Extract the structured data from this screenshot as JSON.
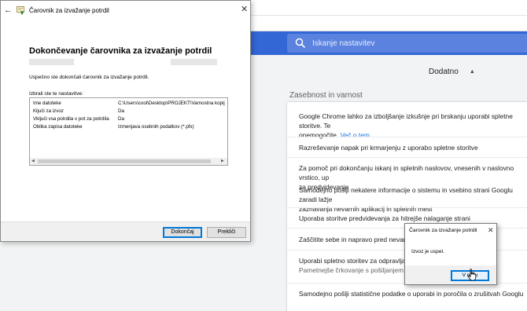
{
  "chrome": {
    "search_placeholder": "Iskanje nastavitev",
    "advanced_label": "Dodatno",
    "section_title": "Zasebnost in varnost",
    "settings": [
      {
        "text": "Google Chrome lahko za izboljšanje izkušnje pri brskanju uporabi spletne storitve. Te",
        "line2": "onemogočite.",
        "link": "Več o tem"
      },
      {
        "text": "Razreševanje napak pri krmarjenju z uporabo spletne storitve"
      },
      {
        "text": "Za pomoč pri dokončanju iskanj in spletnih naslovov, vnesenih v naslovno vrstico, up",
        "line2": "za predvidevanje"
      },
      {
        "text": "Samodejno pošlji nekatere informacije o sistemu in vsebino strani Googlu zaradi lažje",
        "line2": "zaznavanja nevarnih aplikacij in spletnih mest"
      },
      {
        "text": "Uporaba storitve predvidevanja za hitrejše nalaganje strani"
      },
      {
        "text": "Zaščitite sebe in napravo pred nevarnim"
      },
      {
        "text": "Uporabi spletno storitev za odpravljanje",
        "sub": "Pametnejše črkovanje s pošiljanjem vnes"
      },
      {
        "text": "Samodejno pošlji statistične podatke o uporabi in poročila o zrušitvah Googlu"
      }
    ]
  },
  "wizard": {
    "title": "Čarovnik za izvažanje potrdil",
    "heading": "Dokončevanje čarovnika za izvažanje potrdil",
    "success_text": "Uspešno ste dokončali čarovnik za izvažanje potrdil.",
    "specified_label": "Izbrali ste te nastavitve:",
    "summary": [
      {
        "key": "Ime datoteke",
        "value": "C:\\Users\\cool\\Desktop\\PROJEKT\\Varnostna kopij"
      },
      {
        "key": "Ključi za izvoz",
        "value": "Da"
      },
      {
        "key": "Vključi vsa potrdila v pot za potrdila",
        "value": "Da"
      },
      {
        "key": "Oblika zapisa datoteke",
        "value": "Izmenjava osebnih podatkov (*.pfx)"
      }
    ],
    "finish_label": "Dokončaj",
    "cancel_label": "Prekliči"
  },
  "message": {
    "title": "Čarovnik za izvažanje potrdil",
    "text": "Izvoz je uspel.",
    "ok_label": "V redu"
  },
  "colors": {
    "chrome_header": "#3367d6",
    "link": "#1a73e8",
    "accent_focus": "#0078d7"
  },
  "icons": {
    "back": "back-arrow-icon",
    "certificate": "certificate-icon",
    "close": "close-icon",
    "search": "search-icon",
    "chevron": "chevron-up-icon",
    "cursor": "mouse-cursor-icon"
  }
}
